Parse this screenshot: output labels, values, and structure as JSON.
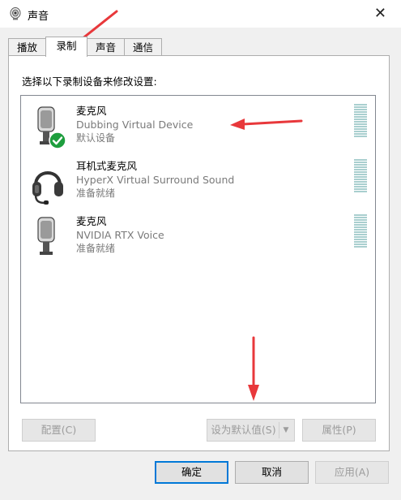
{
  "window": {
    "title": "声音",
    "close_label": "✕"
  },
  "tabs": [
    {
      "label": "播放",
      "active": false
    },
    {
      "label": "录制",
      "active": true
    },
    {
      "label": "声音",
      "active": false
    },
    {
      "label": "通信",
      "active": false
    }
  ],
  "instruction": "选择以下录制设备来修改设置:",
  "devices": [
    {
      "name": "麦克风",
      "description": "Dubbing Virtual Device",
      "status": "默认设备",
      "icon": "microphone-icon",
      "default": true
    },
    {
      "name": "耳机式麦克风",
      "description": "HyperX Virtual Surround Sound",
      "status": "准备就绪",
      "icon": "headset-icon",
      "default": false
    },
    {
      "name": "麦克风",
      "description": "NVIDIA RTX Voice",
      "status": "准备就绪",
      "icon": "microphone-icon",
      "default": false
    }
  ],
  "panel_buttons": {
    "configure": "配置(C)",
    "set_default": "设为默认值(S)",
    "properties": "属性(P)"
  },
  "dialog_buttons": {
    "ok": "确定",
    "cancel": "取消",
    "apply": "应用(A)"
  },
  "colors": {
    "accent": "#0078d7",
    "annotation_arrow": "#e8383b",
    "default_check": "#1e9e3e",
    "meter": "#a9cfcf"
  }
}
